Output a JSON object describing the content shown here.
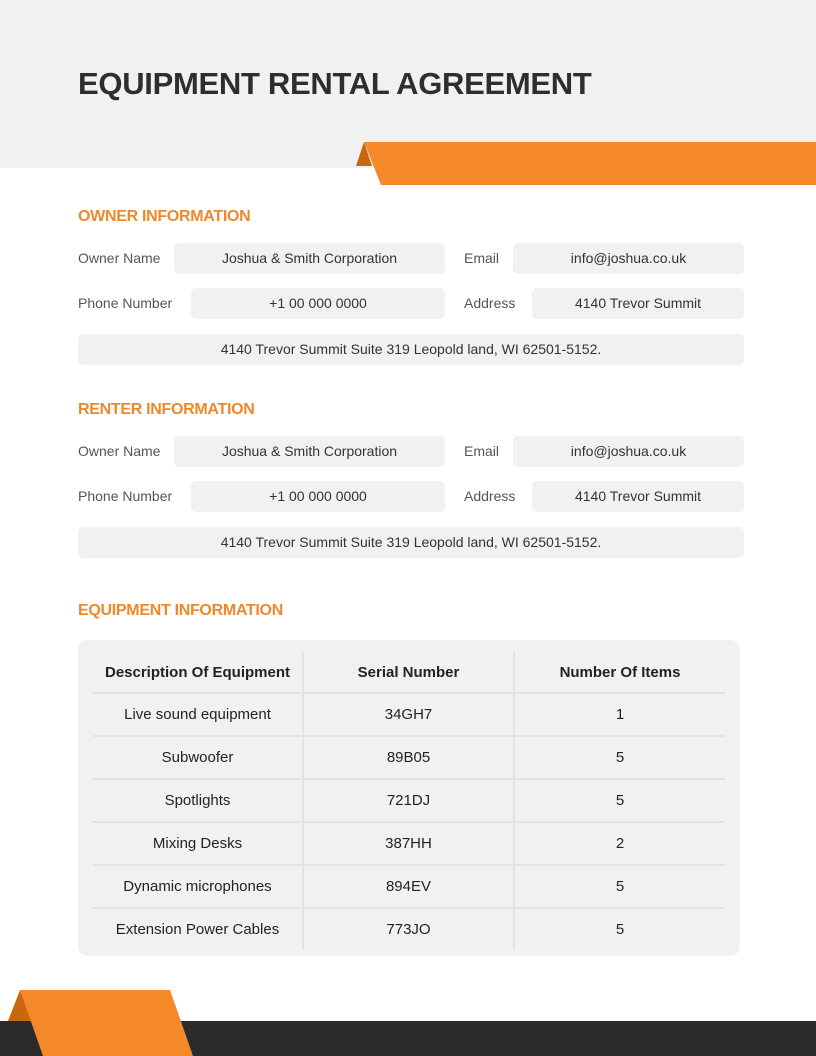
{
  "document": {
    "title": "EQUIPMENT RENTAL AGREEMENT"
  },
  "colors": {
    "accent": "#f5892a",
    "accent_dark": "#c9670f",
    "header_bg": "#f1f1f1",
    "footer_bg": "#2b2b2b"
  },
  "owner": {
    "section_title": "OWNER INFORMATION",
    "name_label": "Owner Name",
    "name_value": "Joshua & Smith Corporation",
    "email_label": "Email",
    "email_value": "info@joshua.co.uk",
    "phone_label": "Phone Number",
    "phone_value": "+1 00 000 0000",
    "address_label": "Address",
    "address_value": "4140 Trevor Summit",
    "full_address": "4140 Trevor Summit  Suite 319 Leopold land, WI 62501-5152."
  },
  "renter": {
    "section_title": "RENTER INFORMATION",
    "name_label": "Owner Name",
    "name_value": "Joshua & Smith Corporation",
    "email_label": "Email",
    "email_value": "info@joshua.co.uk",
    "phone_label": "Phone Number",
    "phone_value": "+1 00 000 0000",
    "address_label": "Address",
    "address_value": "4140 Trevor Summit",
    "full_address": "4140 Trevor Summit  Suite 319 Leopold land, WI 62501-5152."
  },
  "equipment": {
    "section_title": "EQUIPMENT INFORMATION",
    "columns": [
      "Description Of Equipment",
      "Serial Number",
      "Number Of Items"
    ],
    "rows": [
      [
        "Live sound equipment",
        "34GH7",
        "1"
      ],
      [
        "Subwoofer",
        "89B05",
        "5"
      ],
      [
        "Spotlights",
        "721DJ",
        "5"
      ],
      [
        "Mixing Desks",
        "387HH",
        "2"
      ],
      [
        "Dynamic microphones",
        "894EV",
        "5"
      ],
      [
        "Extension Power Cables",
        "773JO",
        "5"
      ]
    ]
  }
}
